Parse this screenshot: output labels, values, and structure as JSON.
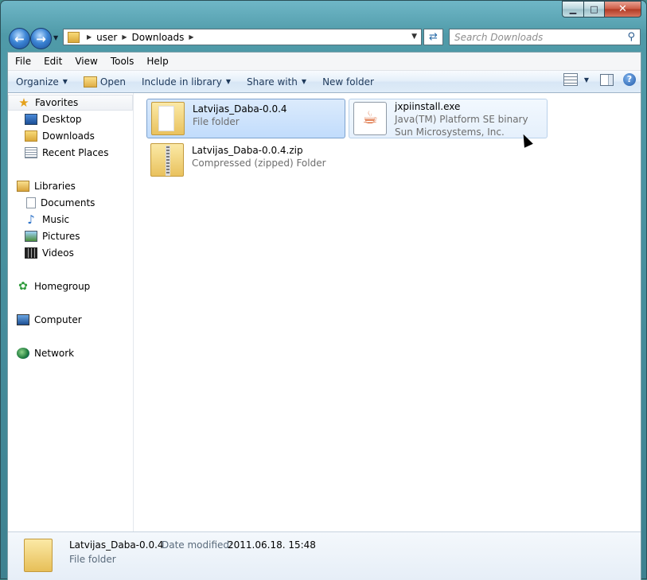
{
  "window": {
    "caption": {
      "minimize": "▁",
      "maximize": "□",
      "close": "✕"
    }
  },
  "navbar": {
    "back": "←",
    "forward": "→",
    "history": "▼",
    "breadcrumbs": [
      "user",
      "Downloads"
    ],
    "address_dropdown": "▼",
    "refresh": "⇄",
    "search_placeholder": "Search Downloads",
    "search_icon": "search-icon"
  },
  "menubar": [
    "File",
    "Edit",
    "View",
    "Tools",
    "Help"
  ],
  "commandbar": {
    "organize": "Organize",
    "open": "Open",
    "include_in_library": "Include in library",
    "share_with": "Share with",
    "new_folder": "New folder",
    "help": "?"
  },
  "navpane": {
    "favorites": {
      "label": "Favorites",
      "items": [
        "Desktop",
        "Downloads",
        "Recent Places"
      ]
    },
    "libraries": {
      "label": "Libraries",
      "items": [
        "Documents",
        "Music",
        "Pictures",
        "Videos"
      ]
    },
    "homegroup": "Homegroup",
    "computer": "Computer",
    "network": "Network"
  },
  "files": [
    {
      "name": "Latvijas_Daba-0.0.4",
      "line2": "File folder",
      "line3": "",
      "icon": "folder-icon",
      "state": "selected"
    },
    {
      "name": "jxpiinstall.exe",
      "line2": "Java(TM) Platform SE binary",
      "line3": "Sun Microsystems, Inc.",
      "icon": "java-icon",
      "state": "hover"
    },
    {
      "name": "Latvijas_Daba-0.0.4.zip",
      "line2": "Compressed (zipped) Folder",
      "line3": "",
      "icon": "zip-folder-icon",
      "state": "normal"
    }
  ],
  "details": {
    "name": "Latvijas_Daba-0.0.4",
    "date_label": "Date modified:",
    "date_value": "2011.06.18. 15:48",
    "type": "File folder"
  }
}
